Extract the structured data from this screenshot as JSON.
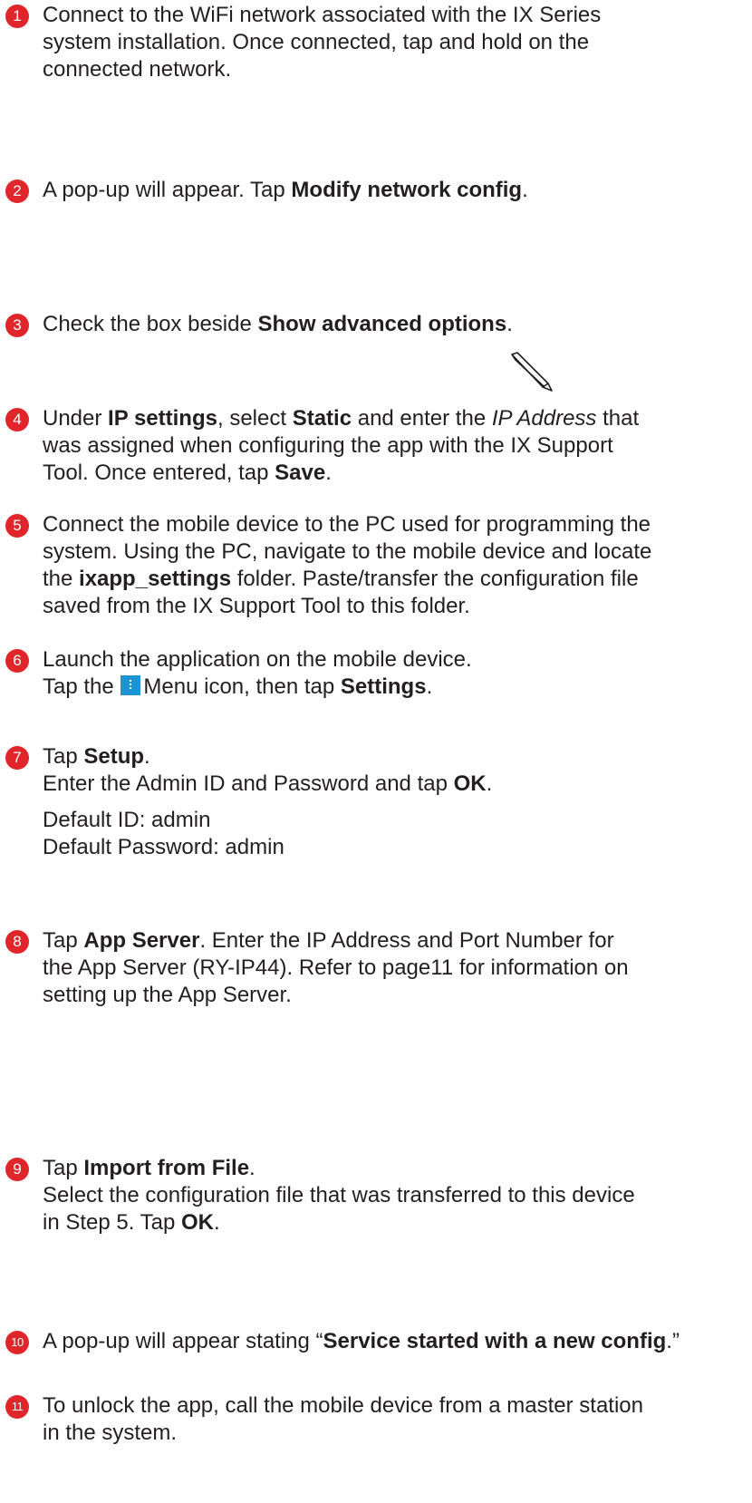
{
  "colors": {
    "badge": "#e0262a",
    "text": "#231f20",
    "menu_icon": "#1e95d3"
  },
  "icons": {
    "menu": "menu-icon",
    "pencil": "pencil-icon"
  },
  "steps": [
    {
      "num": "1",
      "lines": [
        [
          {
            "t": "Connect to the WiFi network associated with the IX Series"
          }
        ],
        [
          {
            "t": "system installation. Once connected, tap and hold on the"
          }
        ],
        [
          {
            "t": "connected network."
          }
        ]
      ]
    },
    {
      "num": "2",
      "lines": [
        [
          {
            "t": "A pop-up will appear. Tap "
          },
          {
            "t": "Modify network config",
            "b": true
          },
          {
            "t": "."
          }
        ]
      ]
    },
    {
      "num": "3",
      "lines": [
        [
          {
            "t": "Check the box beside "
          },
          {
            "t": "Show advanced options",
            "b": true
          },
          {
            "t": "."
          }
        ]
      ]
    },
    {
      "num": "4",
      "lines": [
        [
          {
            "t": "Under "
          },
          {
            "t": "IP settings",
            "b": true
          },
          {
            "t": ", select "
          },
          {
            "t": "Static",
            "b": true
          },
          {
            "t": " and enter the "
          },
          {
            "t": "IP Address",
            "i": true
          },
          {
            "t": " that"
          }
        ],
        [
          {
            "t": "was assigned when configuring the app with the IX Support"
          }
        ],
        [
          {
            "t": "Tool. Once entered, tap "
          },
          {
            "t": "Save",
            "b": true
          },
          {
            "t": "."
          }
        ]
      ]
    },
    {
      "num": "5",
      "lines": [
        [
          {
            "t": "Connect the mobile device to the PC used for programming the"
          }
        ],
        [
          {
            "t": "system. Using the PC, navigate to the mobile device and locate"
          }
        ],
        [
          {
            "t": "the "
          },
          {
            "t": "ixapp_settings",
            "b": true
          },
          {
            "t": " folder. Paste/transfer the configuration file"
          }
        ],
        [
          {
            "t": "saved from the IX Support Tool to this folder."
          }
        ]
      ]
    },
    {
      "num": "6",
      "lines": [
        [
          {
            "t": "Launch the application on the mobile device."
          }
        ],
        [
          {
            "t": "Tap the "
          },
          {
            "icon": "menu"
          },
          {
            "t": "Menu icon, then tap "
          },
          {
            "t": "Settings",
            "b": true
          },
          {
            "t": "."
          }
        ]
      ]
    },
    {
      "num": "7",
      "lines": [
        [
          {
            "t": "Tap "
          },
          {
            "t": "Setup",
            "b": true
          },
          {
            "t": "."
          }
        ],
        [
          {
            "t": "Enter the Admin ID and Password and tap "
          },
          {
            "t": "OK",
            "b": true
          },
          {
            "t": "."
          }
        ],
        "gap",
        [
          {
            "t": "Default ID: admin"
          }
        ],
        [
          {
            "t": "Default Password: admin"
          }
        ]
      ]
    },
    {
      "num": "8",
      "lines": [
        [
          {
            "t": "Tap "
          },
          {
            "t": "App Server",
            "b": true
          },
          {
            "t": ". Enter the IP Address and Port Number for"
          }
        ],
        [
          {
            "t": "the App Server (RY-IP44). Refer to page11 for information on"
          }
        ],
        [
          {
            "t": "setting up the App Server."
          }
        ]
      ]
    },
    {
      "num": "9",
      "lines": [
        [
          {
            "t": "Tap "
          },
          {
            "t": "Import from File",
            "b": true
          },
          {
            "t": "."
          }
        ],
        [
          {
            "t": "Select the configuration file that was transferred to this device"
          }
        ],
        [
          {
            "t": "in Step 5. Tap "
          },
          {
            "t": "OK",
            "b": true
          },
          {
            "t": "."
          }
        ]
      ]
    },
    {
      "num": "10",
      "lines": [
        [
          {
            "t": "A pop-up will appear stating “"
          },
          {
            "t": "Service started with a new config",
            "b": true
          },
          {
            "t": ".”"
          }
        ]
      ]
    },
    {
      "num": "11",
      "lines": [
        [
          {
            "t": "To unlock the app, call the mobile device from a master station"
          }
        ],
        [
          {
            "t": "in the system."
          }
        ]
      ]
    }
  ]
}
